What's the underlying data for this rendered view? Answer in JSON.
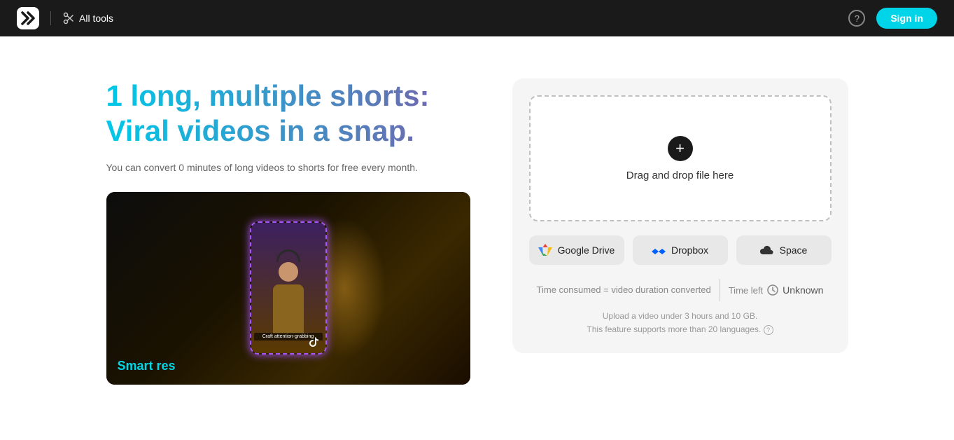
{
  "navbar": {
    "logo_alt": "CapCut Logo",
    "all_tools_label": "All tools",
    "help_icon": "question-mark",
    "sign_in_label": "Sign in"
  },
  "hero": {
    "headline": "1 long, multiple shorts: Viral videos in a snap.",
    "subtext": "You can convert 0 minutes of long videos to shorts for free every month.",
    "video_caption": "Craft attention-grabbing",
    "video_bottom_text": "Smart res",
    "video_tiktok": "d"
  },
  "upload": {
    "drop_label": "Drag and drop file here",
    "plus_icon": "+",
    "google_drive_label": "Google Drive",
    "dropbox_label": "Dropbox",
    "space_label": "Space",
    "time_consumed_label": "Time consumed = video duration\nconverted",
    "time_left_label": "Time left",
    "unknown_label": "Unknown",
    "upload_note_line1": "Upload a video under 3 hours and 10 GB.",
    "upload_note_line2": "This feature supports more than 20 languages.",
    "info_icon": "?"
  }
}
